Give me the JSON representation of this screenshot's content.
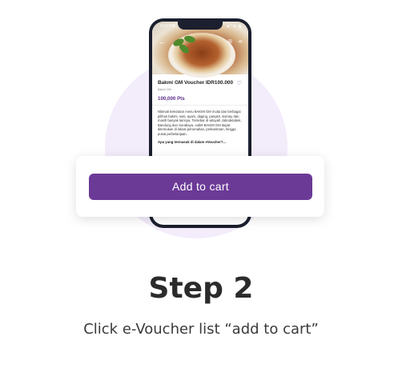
{
  "phone": {
    "status_time": "9:12 PM",
    "status_icons": "▲ ✦ ▮",
    "back_icon": "arrow-left-icon",
    "cart_icon": "cart-icon",
    "share_icon": "share-icon",
    "product_title": "Bakmi GM Voucher IDR100.000",
    "product_sub": "Bakmi GM",
    "points": "100,000 Pts",
    "description": "Nikmati kelezatan menu BAKMI GM mulai dan berbagai pilihan bakmi, nasi, ayam, daging, pangsit, siomay dan masih banyak lainnya. Tersebar di wilayah Jabodetabek, Bandung dan Surabaya, outlet BAKMI GM dapat ditemukan di lokasi perumahan, perkantoran, hingga pusat perbelanjaan.",
    "faq": "Apa yang termasuk di dalam eVoucher?..."
  },
  "card": {
    "button_label": "Add to cart"
  },
  "step_title": "Step 2",
  "instruction": "Click e-Voucher list “add to cart”",
  "colors": {
    "accent": "#6b3a97",
    "circle": "#f3ecfb"
  }
}
